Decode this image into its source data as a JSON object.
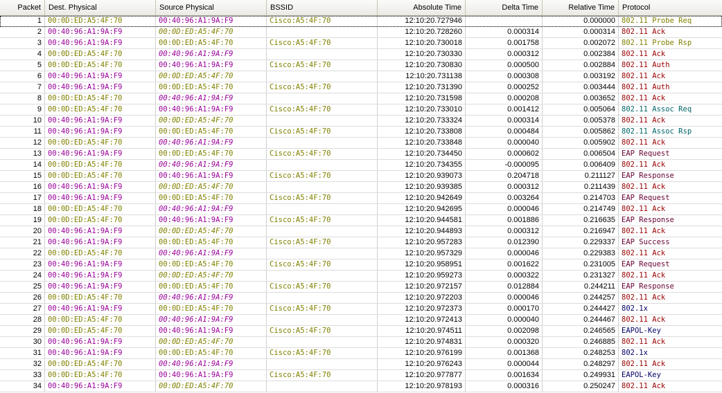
{
  "colors": {
    "mac_olive": "#808000",
    "mac_purple": "#990099",
    "proto_mgmt": "#808000",
    "proto_ack": "#990000",
    "proto_assoc": "#006666",
    "proto_eap": "#660033",
    "proto_dot1x": "#000066"
  },
  "columns": [
    "Packet",
    "Dest. Physical",
    "Source Physical",
    "BSSID",
    "Absolute Time",
    "Delta Time",
    "Relative Time",
    "Protocol"
  ],
  "rows": [
    {
      "packet": "1",
      "dest": "00:0D:ED:A5:4F:70",
      "src": "00:40:96:A1:9A:F9",
      "bssid": "Cisco:A5:4F:70",
      "abs": "12:10:20.727946",
      "delta": "",
      "rel": "0.000000",
      "proto": "802.11 Probe Req",
      "pcolor": "#808000"
    },
    {
      "packet": "2",
      "dest": "00:40:96:A1:9A:F9",
      "src": "00:0D:ED:A5:4F:70",
      "bssid": "",
      "abs": "12:10:20.728260",
      "delta": "0.000314",
      "rel": "0.000314",
      "proto": "802.11 Ack",
      "pcolor": "#990000"
    },
    {
      "packet": "3",
      "dest": "00:40:96:A1:9A:F9",
      "src": "00:0D:ED:A5:4F:70",
      "bssid": "Cisco:A5:4F:70",
      "abs": "12:10:20.730018",
      "delta": "0.001758",
      "rel": "0.002072",
      "proto": "802.11 Probe Rsp",
      "pcolor": "#808000"
    },
    {
      "packet": "4",
      "dest": "00:0D:ED:A5:4F:70",
      "src": "00:40:96:A1:9A:F9",
      "bssid": "",
      "abs": "12:10:20.730330",
      "delta": "0.000312",
      "rel": "0.002384",
      "proto": "802.11 Ack",
      "pcolor": "#990000"
    },
    {
      "packet": "5",
      "dest": "00:0D:ED:A5:4F:70",
      "src": "00:40:96:A1:9A:F9",
      "bssid": "Cisco:A5:4F:70",
      "abs": "12:10:20.730830",
      "delta": "0.000500",
      "rel": "0.002884",
      "proto": "802.11 Auth",
      "pcolor": "#990000"
    },
    {
      "packet": "6",
      "dest": "00:40:96:A1:9A:F9",
      "src": "00:0D:ED:A5:4F:70",
      "bssid": "",
      "abs": "12:10:20.731138",
      "delta": "0.000308",
      "rel": "0.003192",
      "proto": "802.11 Ack",
      "pcolor": "#990000"
    },
    {
      "packet": "7",
      "dest": "00:40:96:A1:9A:F9",
      "src": "00:0D:ED:A5:4F:70",
      "bssid": "Cisco:A5:4F:70",
      "abs": "12:10:20.731390",
      "delta": "0.000252",
      "rel": "0.003444",
      "proto": "802.11 Auth",
      "pcolor": "#990000"
    },
    {
      "packet": "8",
      "dest": "00:0D:ED:A5:4F:70",
      "src": "00:40:96:A1:9A:F9",
      "bssid": "",
      "abs": "12:10:20.731598",
      "delta": "0.000208",
      "rel": "0.003652",
      "proto": "802.11 Ack",
      "pcolor": "#990000"
    },
    {
      "packet": "9",
      "dest": "00:0D:ED:A5:4F:70",
      "src": "00:40:96:A1:9A:F9",
      "bssid": "Cisco:A5:4F:70",
      "abs": "12:10:20.733010",
      "delta": "0.001412",
      "rel": "0.005064",
      "proto": "802.11 Assoc Req",
      "pcolor": "#006666"
    },
    {
      "packet": "10",
      "dest": "00:40:96:A1:9A:F9",
      "src": "00:0D:ED:A5:4F:70",
      "bssid": "",
      "abs": "12:10:20.733324",
      "delta": "0.000314",
      "rel": "0.005378",
      "proto": "802.11 Ack",
      "pcolor": "#990000"
    },
    {
      "packet": "11",
      "dest": "00:40:96:A1:9A:F9",
      "src": "00:0D:ED:A5:4F:70",
      "bssid": "Cisco:A5:4F:70",
      "abs": "12:10:20.733808",
      "delta": "0.000484",
      "rel": "0.005862",
      "proto": "802.11 Assoc Rsp",
      "pcolor": "#006666"
    },
    {
      "packet": "12",
      "dest": "00:0D:ED:A5:4F:70",
      "src": "00:40:96:A1:9A:F9",
      "bssid": "",
      "abs": "12:10:20.733848",
      "delta": "0.000040",
      "rel": "0.005902",
      "proto": "802.11 Ack",
      "pcolor": "#990000"
    },
    {
      "packet": "13",
      "dest": "00:40:96:A1:9A:F9",
      "src": "00:0D:ED:A5:4F:70",
      "bssid": "Cisco:A5:4F:70",
      "abs": "12:10:20.734450",
      "delta": "0.000602",
      "rel": "0.006504",
      "proto": "EAP Request",
      "pcolor": "#660033"
    },
    {
      "packet": "14",
      "dest": "00:0D:ED:A5:4F:70",
      "src": "00:40:96:A1:9A:F9",
      "bssid": "",
      "abs": "12:10:20.734355",
      "delta": "-0.000095",
      "rel": "0.006409",
      "proto": "802.11 Ack",
      "pcolor": "#990000"
    },
    {
      "packet": "15",
      "dest": "00:0D:ED:A5:4F:70",
      "src": "00:40:96:A1:9A:F9",
      "bssid": "Cisco:A5:4F:70",
      "abs": "12:10:20.939073",
      "delta": "0.204718",
      "rel": "0.211127",
      "proto": "EAP Response",
      "pcolor": "#660033"
    },
    {
      "packet": "16",
      "dest": "00:40:96:A1:9A:F9",
      "src": "00:0D:ED:A5:4F:70",
      "bssid": "",
      "abs": "12:10:20.939385",
      "delta": "0.000312",
      "rel": "0.211439",
      "proto": "802.11 Ack",
      "pcolor": "#990000"
    },
    {
      "packet": "17",
      "dest": "00:40:96:A1:9A:F9",
      "src": "00:0D:ED:A5:4F:70",
      "bssid": "Cisco:A5:4F:70",
      "abs": "12:10:20.942649",
      "delta": "0.003264",
      "rel": "0.214703",
      "proto": "EAP Request",
      "pcolor": "#660033"
    },
    {
      "packet": "18",
      "dest": "00:0D:ED:A5:4F:70",
      "src": "00:40:96:A1:9A:F9",
      "bssid": "",
      "abs": "12:10:20.942695",
      "delta": "0.000046",
      "rel": "0.214749",
      "proto": "802.11 Ack",
      "pcolor": "#990000"
    },
    {
      "packet": "19",
      "dest": "00:0D:ED:A5:4F:70",
      "src": "00:40:96:A1:9A:F9",
      "bssid": "Cisco:A5:4F:70",
      "abs": "12:10:20.944581",
      "delta": "0.001886",
      "rel": "0.216635",
      "proto": "EAP Response",
      "pcolor": "#660033"
    },
    {
      "packet": "20",
      "dest": "00:40:96:A1:9A:F9",
      "src": "00:0D:ED:A5:4F:70",
      "bssid": "",
      "abs": "12:10:20.944893",
      "delta": "0.000312",
      "rel": "0.216947",
      "proto": "802.11 Ack",
      "pcolor": "#990000"
    },
    {
      "packet": "21",
      "dest": "00:40:96:A1:9A:F9",
      "src": "00:0D:ED:A5:4F:70",
      "bssid": "Cisco:A5:4F:70",
      "abs": "12:10:20.957283",
      "delta": "0.012390",
      "rel": "0.229337",
      "proto": "EAP Success",
      "pcolor": "#660033"
    },
    {
      "packet": "22",
      "dest": "00:0D:ED:A5:4F:70",
      "src": "00:40:96:A1:9A:F9",
      "bssid": "",
      "abs": "12:10:20.957329",
      "delta": "0.000046",
      "rel": "0.229383",
      "proto": "802.11 Ack",
      "pcolor": "#990000"
    },
    {
      "packet": "23",
      "dest": "00:40:96:A1:9A:F9",
      "src": "00:0D:ED:A5:4F:70",
      "bssid": "Cisco:A5:4F:70",
      "abs": "12:10:20.958951",
      "delta": "0.001622",
      "rel": "0.231005",
      "proto": "EAP Request",
      "pcolor": "#660033"
    },
    {
      "packet": "24",
      "dest": "00:40:96:A1:9A:F9",
      "src": "00:0D:ED:A5:4F:70",
      "bssid": "",
      "abs": "12:10:20.959273",
      "delta": "0.000322",
      "rel": "0.231327",
      "proto": "802.11 Ack",
      "pcolor": "#990000"
    },
    {
      "packet": "25",
      "dest": "00:40:96:A1:9A:F9",
      "src": "00:0D:ED:A5:4F:70",
      "bssid": "Cisco:A5:4F:70",
      "abs": "12:10:20.972157",
      "delta": "0.012884",
      "rel": "0.244211",
      "proto": "EAP Response",
      "pcolor": "#660033"
    },
    {
      "packet": "26",
      "dest": "00:0D:ED:A5:4F:70",
      "src": "00:40:96:A1:9A:F9",
      "bssid": "",
      "abs": "12:10:20.972203",
      "delta": "0.000046",
      "rel": "0.244257",
      "proto": "802.11 Ack",
      "pcolor": "#990000"
    },
    {
      "packet": "27",
      "dest": "00:40:96:A1:9A:F9",
      "src": "00:0D:ED:A5:4F:70",
      "bssid": "Cisco:A5:4F:70",
      "abs": "12:10:20.972373",
      "delta": "0.000170",
      "rel": "0.244427",
      "proto": "802.1x",
      "pcolor": "#000066"
    },
    {
      "packet": "28",
      "dest": "00:0D:ED:A5:4F:70",
      "src": "00:40:96:A1:9A:F9",
      "bssid": "",
      "abs": "12:10:20.972413",
      "delta": "0.000040",
      "rel": "0.244467",
      "proto": "802.11 Ack",
      "pcolor": "#990000"
    },
    {
      "packet": "29",
      "dest": "00:0D:ED:A5:4F:70",
      "src": "00:40:96:A1:9A:F9",
      "bssid": "Cisco:A5:4F:70",
      "abs": "12:10:20.974511",
      "delta": "0.002098",
      "rel": "0.246565",
      "proto": "EAPOL-Key",
      "pcolor": "#000066"
    },
    {
      "packet": "30",
      "dest": "00:40:96:A1:9A:F9",
      "src": "00:0D:ED:A5:4F:70",
      "bssid": "",
      "abs": "12:10:20.974831",
      "delta": "0.000320",
      "rel": "0.246885",
      "proto": "802.11 Ack",
      "pcolor": "#990000"
    },
    {
      "packet": "31",
      "dest": "00:40:96:A1:9A:F9",
      "src": "00:0D:ED:A5:4F:70",
      "bssid": "Cisco:A5:4F:70",
      "abs": "12:10:20.976199",
      "delta": "0.001368",
      "rel": "0.248253",
      "proto": "802.1x",
      "pcolor": "#000066"
    },
    {
      "packet": "32",
      "dest": "00:0D:ED:A5:4F:70",
      "src": "00:40:96:A1:9A:F9",
      "bssid": "",
      "abs": "12:10:20.976243",
      "delta": "0.000044",
      "rel": "0.248297",
      "proto": "802.11 Ack",
      "pcolor": "#990000"
    },
    {
      "packet": "33",
      "dest": "00:0D:ED:A5:4F:70",
      "src": "00:40:96:A1:9A:F9",
      "bssid": "Cisco:A5:4F:70",
      "abs": "12:10:20.977877",
      "delta": "0.001634",
      "rel": "0.249931",
      "proto": "EAPOL-Key",
      "pcolor": "#000066"
    },
    {
      "packet": "34",
      "dest": "00:40:96:A1:9A:F9",
      "src": "00:0D:ED:A5:4F:70",
      "bssid": "",
      "abs": "12:10:20.978193",
      "delta": "0.000316",
      "rel": "0.250247",
      "proto": "802.11 Ack",
      "pcolor": "#990000"
    }
  ]
}
